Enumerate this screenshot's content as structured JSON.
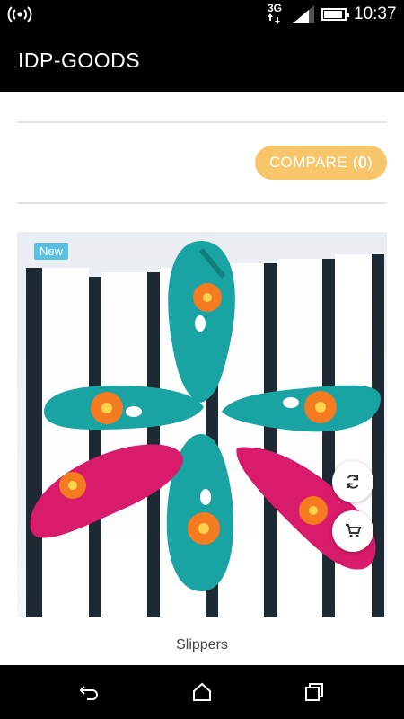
{
  "status_bar": {
    "network": "3G",
    "time": "10:37",
    "battery_level": 0.9,
    "signal_level": 0.75
  },
  "app_bar": {
    "title": "IDP-GOODS"
  },
  "compare": {
    "label": "COMPARE",
    "open_paren": "(",
    "count": "0",
    "close_paren": ")"
  },
  "product": {
    "badge": "New",
    "name": "Slippers"
  },
  "icons": {
    "hotspot": "wifi-hotspot-icon",
    "compare_action": "refresh-icon",
    "cart_action": "cart-icon",
    "back": "back-icon",
    "home": "home-icon",
    "recents": "recents-icon"
  },
  "colors": {
    "compare_button": "#f8c66a",
    "badge": "#5bc0de",
    "app_bar": "#000000"
  }
}
